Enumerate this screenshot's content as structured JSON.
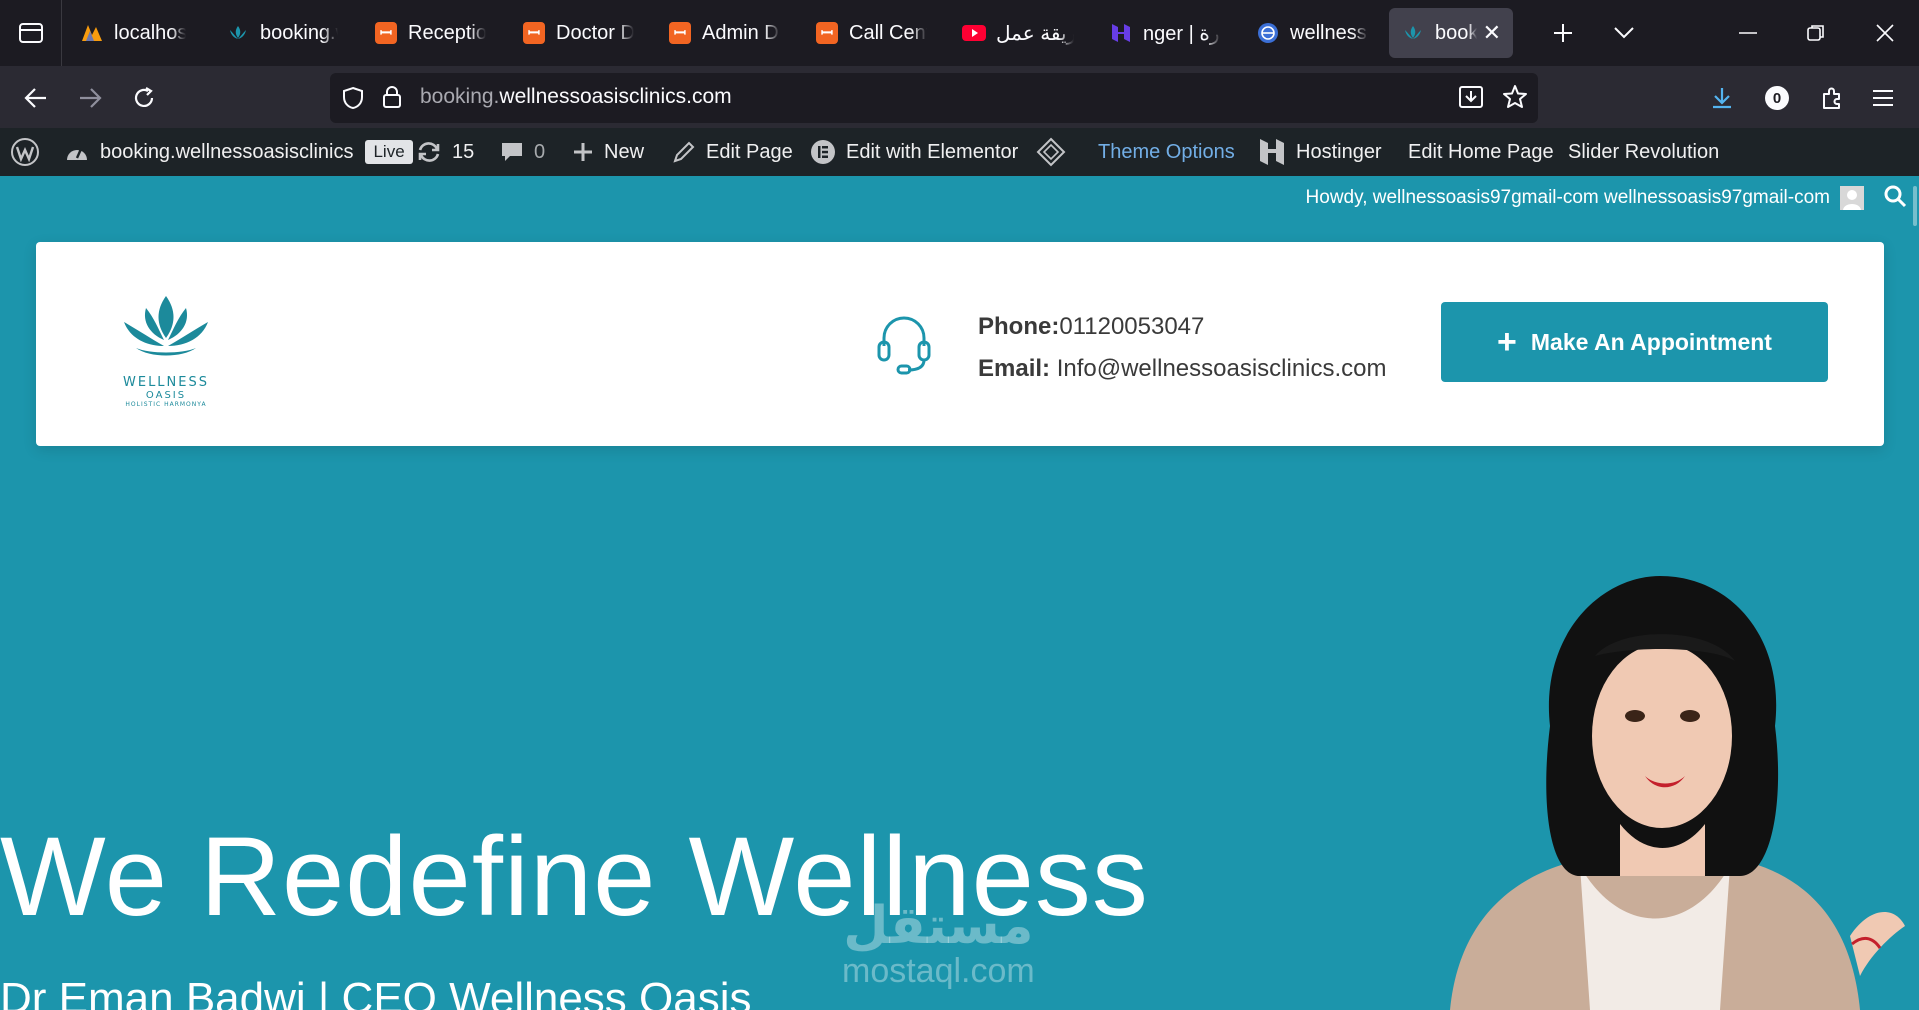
{
  "browser": {
    "tabs": [
      {
        "title": "localhost /",
        "icon": "phpmyadmin-icon",
        "active": false
      },
      {
        "title": "booking.w",
        "icon": "lotus-icon",
        "active": false
      },
      {
        "title": "Reception",
        "icon": "xampp-icon",
        "active": false
      },
      {
        "title": "Doctor Da",
        "icon": "xampp-icon",
        "active": false
      },
      {
        "title": "Admin Da",
        "icon": "xampp-icon",
        "active": false
      },
      {
        "title": "Call Cente",
        "icon": "xampp-icon",
        "active": false
      },
      {
        "title": "طريقة عمل",
        "icon": "youtube-icon",
        "active": false
      },
      {
        "title": "nger | إدارة",
        "icon": "hostinger-icon",
        "active": false
      },
      {
        "title": "wellnesso",
        "icon": "globe-icon",
        "active": false
      },
      {
        "title": "booking",
        "icon": "lotus-icon",
        "active": true
      }
    ],
    "url_prefix": "booking.",
    "url_domain": "wellnessoasisclinics.com",
    "download_badge": "0"
  },
  "wp_admin_bar": {
    "site_name": "booking.wellnessoasisclinics",
    "live_badge": "Live",
    "updates_count": "15",
    "comments_count": "0",
    "new_label": "New",
    "edit_page_label": "Edit Page",
    "elementor_label": "Edit with Elementor",
    "theme_options_label": "Theme Options",
    "hostinger_label": "Hostinger",
    "edit_home_label": "Edit Home Page",
    "slider_label": "Slider Revolution",
    "howdy_text": "Howdy, wellnessoasis97gmail-com wellnessoasis97gmail-com"
  },
  "site_header": {
    "logo_word1": "WELLNESS",
    "logo_word2": "OASIS",
    "logo_tagline": "HOLISTIC HARMONYA",
    "phone_label": "Phone:",
    "phone_value": "01120053047",
    "email_label": "Email:",
    "email_value": " Info@wellnessoasisclinics.com",
    "cta_label": "Make An Appointment"
  },
  "hero": {
    "title": "We Redefine Wellness",
    "subtitle": "Dr Eman Badwi | CEO Wellness Oasis"
  },
  "watermark": {
    "line1": "مستقل",
    "line2": "mostaql.com"
  },
  "colors": {
    "brand_teal": "#1c95ac",
    "wp_bar": "#1d2327",
    "theme_options_accent": "#72aee6"
  }
}
